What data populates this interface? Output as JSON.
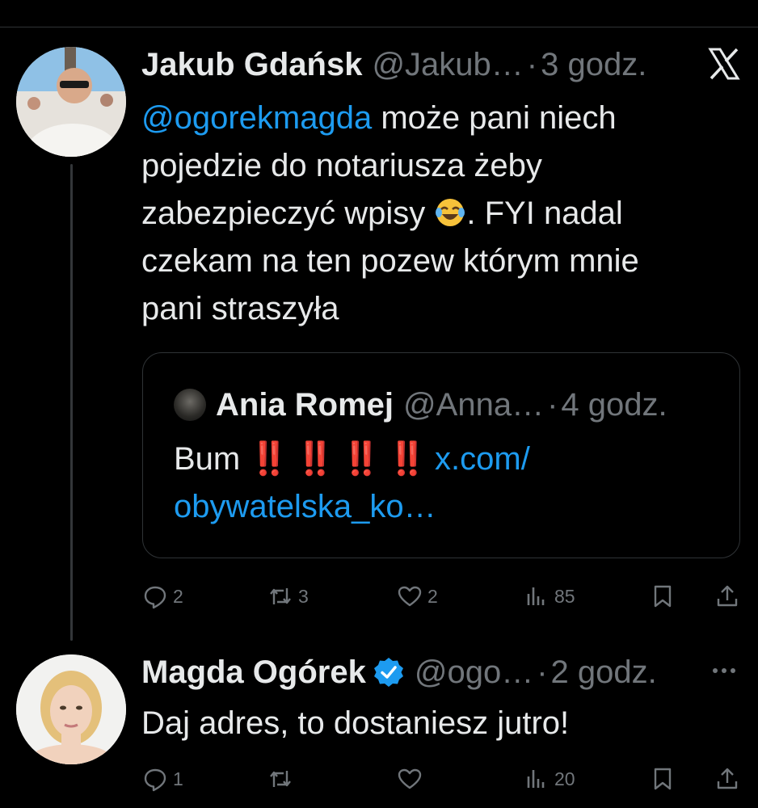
{
  "tweets": [
    {
      "author_name": "Jakub Gdańsk",
      "handle": "@Jakub…",
      "dot": "·",
      "time": "3 godz.",
      "mention": "@ogorekmagda",
      "text_after_mention": " może pani niech pojedzie do notariusza żeby zabezpieczyć wpisy ",
      "emoji": "face-with-tears-of-joy",
      "text_end": ". FYI nadal czekam na ten pozew którym mnie pani straszyła",
      "quote": {
        "author_name": "Ania Romej",
        "handle": "@Anna…",
        "dot": "·",
        "time": "4 godz.",
        "text": "Bum ",
        "bangs": "‼️ ‼️ ‼️ ‼️",
        "link": "x.com/ obywatelska_ko…"
      },
      "actions": {
        "reply": "2",
        "retweet": "3",
        "like": "2",
        "views": "85"
      }
    },
    {
      "author_name": "Magda Ogórek",
      "handle": "@ogo…",
      "dot": "·",
      "time": "2 godz.",
      "text": "Daj adres, to dostaniesz jutro!",
      "actions": {
        "reply": "1",
        "retweet": "",
        "like": "",
        "views": "20"
      }
    }
  ],
  "icons": {
    "x_logo": "x-logo-icon",
    "more": "more-horizontal-icon",
    "verified": "verified-badge-icon"
  },
  "colors": {
    "accent": "#1d9bf0",
    "muted": "#71767b",
    "background": "#000000"
  }
}
